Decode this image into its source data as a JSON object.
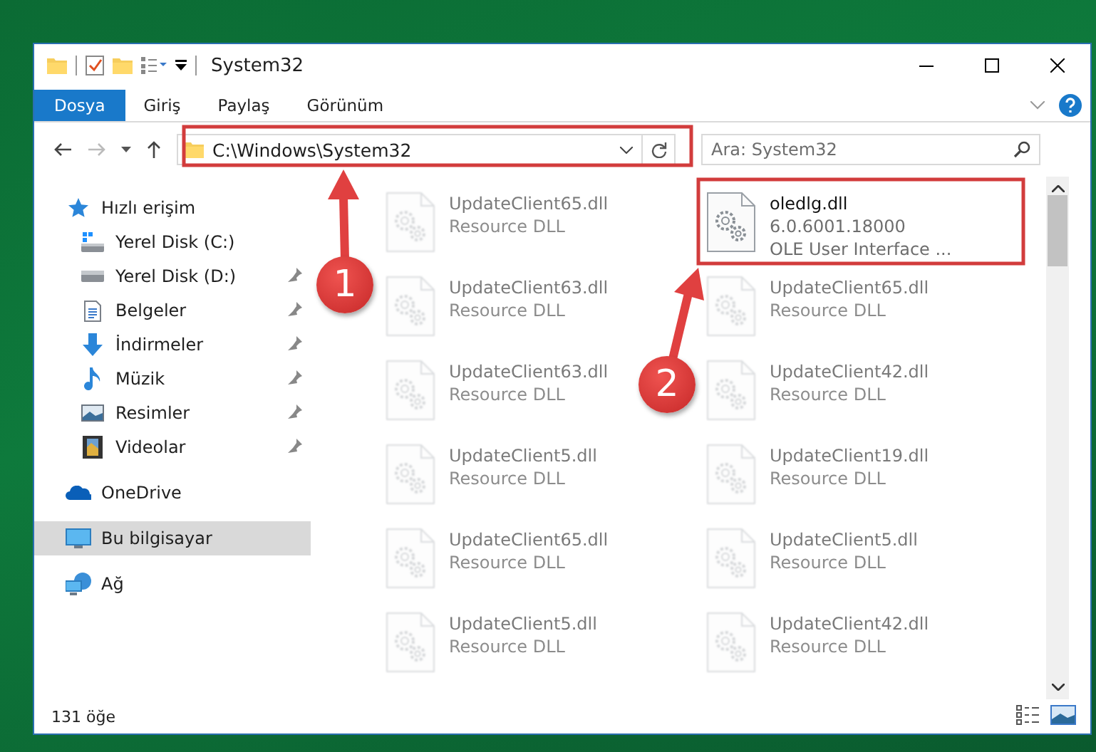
{
  "window": {
    "title": "System32"
  },
  "ribbon_tabs": [
    {
      "label": "Dosya",
      "selected": true
    },
    {
      "label": "Giriş",
      "selected": false
    },
    {
      "label": "Paylaş",
      "selected": false
    },
    {
      "label": "Görünüm",
      "selected": false
    }
  ],
  "address": {
    "value": "C:\\Windows\\System32"
  },
  "search": {
    "placeholder": "Ara: System32"
  },
  "sidebar": {
    "items": [
      {
        "label": "Hızlı erişim",
        "kind": "star",
        "selected": false,
        "children": [
          {
            "label": "Yerel Disk (C:)",
            "kind": "drive-c",
            "pinned": false,
            "selected": false
          },
          {
            "label": "Yerel Disk (D:)",
            "kind": "drive",
            "pinned": true,
            "selected": false
          },
          {
            "label": "Belgeler",
            "kind": "document",
            "pinned": true,
            "selected": false
          },
          {
            "label": "İndirmeler",
            "kind": "download",
            "pinned": true,
            "selected": false
          },
          {
            "label": "Müzik",
            "kind": "music",
            "pinned": true,
            "selected": false
          },
          {
            "label": "Resimler",
            "kind": "image",
            "pinned": true,
            "selected": false
          },
          {
            "label": "Videolar",
            "kind": "video",
            "pinned": true,
            "selected": false
          }
        ]
      },
      {
        "label": "OneDrive",
        "kind": "cloud",
        "selected": false
      },
      {
        "label": "Bu bilgisayar",
        "kind": "computer",
        "selected": true
      },
      {
        "label": "Ağ",
        "kind": "network",
        "selected": false
      }
    ]
  },
  "files": [
    {
      "name": "UpdateClient65.dll",
      "details": [
        "Resource DLL"
      ],
      "dimmed": true
    },
    {
      "name": "oledlg.dll",
      "details": [
        "6.0.6001.18000",
        "OLE User Interface ..."
      ],
      "dimmed": false
    },
    {
      "name": "UpdateClient63.dll",
      "details": [
        "Resource DLL"
      ],
      "dimmed": true
    },
    {
      "name": "UpdateClient65.dll",
      "details": [
        "Resource DLL"
      ],
      "dimmed": true
    },
    {
      "name": "UpdateClient63.dll",
      "details": [
        "Resource DLL"
      ],
      "dimmed": true
    },
    {
      "name": "UpdateClient42.dll",
      "details": [
        "Resource DLL"
      ],
      "dimmed": true
    },
    {
      "name": "UpdateClient5.dll",
      "details": [
        "Resource DLL"
      ],
      "dimmed": true
    },
    {
      "name": "UpdateClient19.dll",
      "details": [
        "Resource DLL"
      ],
      "dimmed": true
    },
    {
      "name": "UpdateClient65.dll",
      "details": [
        "Resource DLL"
      ],
      "dimmed": true
    },
    {
      "name": "UpdateClient5.dll",
      "details": [
        "Resource DLL"
      ],
      "dimmed": true
    },
    {
      "name": "UpdateClient5.dll",
      "details": [
        "Resource DLL"
      ],
      "dimmed": true
    },
    {
      "name": "UpdateClient42.dll",
      "details": [
        "Resource DLL"
      ],
      "dimmed": true
    }
  ],
  "status_bar": {
    "item_count": "131 öğe"
  },
  "annotations": [
    {
      "label": "1"
    },
    {
      "label": "2"
    }
  ]
}
